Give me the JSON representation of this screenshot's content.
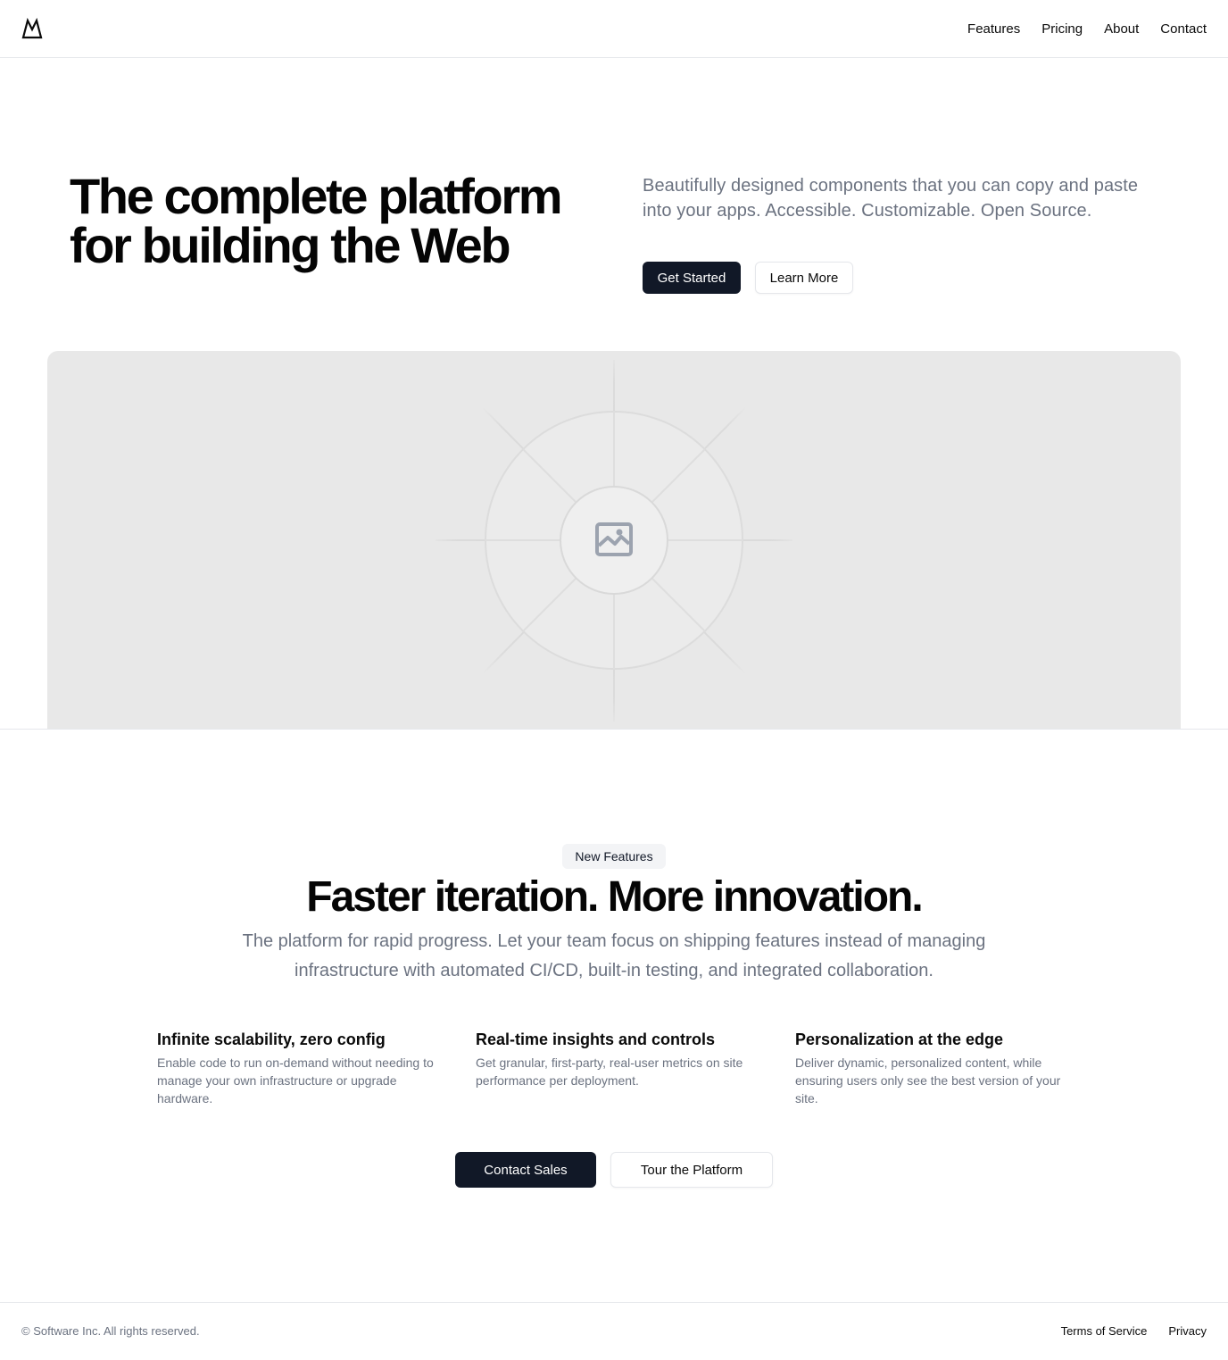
{
  "header": {
    "logo_icon": "mountain-logo-icon",
    "nav": [
      "Features",
      "Pricing",
      "About",
      "Contact"
    ]
  },
  "hero": {
    "title_line1": "The complete platform",
    "title_line2": "for building the Web",
    "description": "Beautifully designed components that you can copy and paste into your apps. Accessible. Customizable. Open Source.",
    "primary_button": "Get Started",
    "secondary_button": "Learn More",
    "image_icon": "image-placeholder-icon"
  },
  "features_section": {
    "badge": "New Features",
    "title": "Faster iteration. More innovation.",
    "description": "The platform for rapid progress. Let your team focus on shipping features instead of managing infrastructure with automated CI/CD, built-in testing, and integrated collaboration.",
    "features": [
      {
        "title": "Infinite scalability, zero config",
        "text": "Enable code to run on-demand without needing to manage your own infrastructure or upgrade hardware."
      },
      {
        "title": "Real-time insights and controls",
        "text": "Get granular, first-party, real-user metrics on site performance per deployment."
      },
      {
        "title": "Personalization at the edge",
        "text": "Deliver dynamic, personalized content, while ensuring users only see the best version of your site."
      }
    ],
    "primary_button": "Contact Sales",
    "secondary_button": "Tour the Platform"
  },
  "footer": {
    "copyright": "© Software Inc. All rights reserved.",
    "links": [
      "Terms of Service",
      "Privacy"
    ]
  },
  "colors": {
    "primary_dark": "#111827",
    "muted_text": "#6b7280",
    "border": "#e5e7eb",
    "placeholder_bg": "#e8e8e8"
  }
}
